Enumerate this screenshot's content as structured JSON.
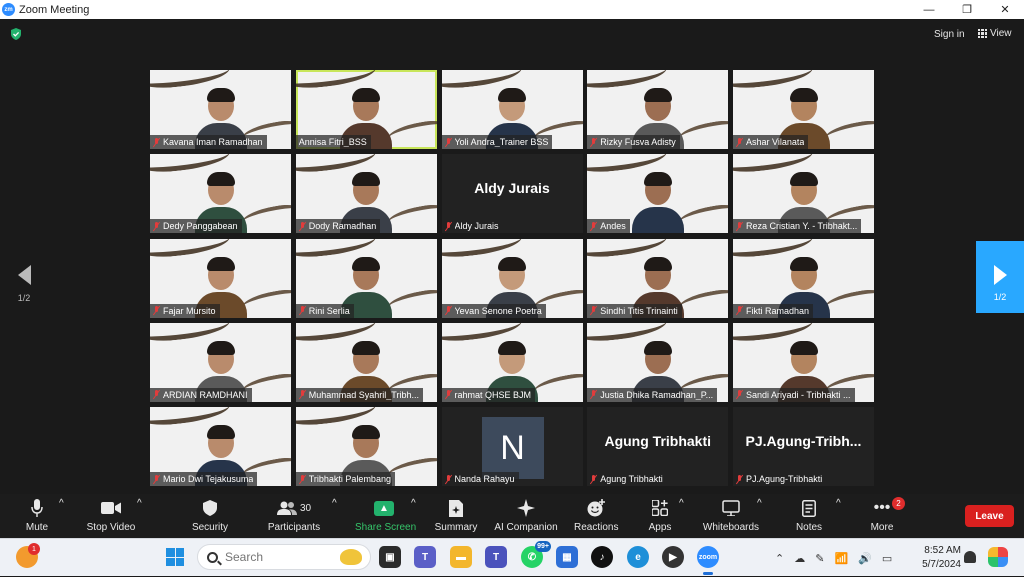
{
  "window": {
    "title": "Zoom Meeting",
    "logo_text": "zm",
    "controls": [
      "—",
      "❐",
      "✕"
    ]
  },
  "header": {
    "sign_in": "Sign in",
    "view": "View"
  },
  "pagination": {
    "prev_page": "1/2",
    "next_page": "1/2"
  },
  "participants": [
    {
      "name": "Kavana Iman Ramadhan",
      "muted": true,
      "video": true
    },
    {
      "name": "Annisa Fitri_BSS",
      "muted": false,
      "video": true,
      "active_speaker": true
    },
    {
      "name": "Yoli Andra_Trainer BSS",
      "muted": true,
      "video": true
    },
    {
      "name": "Rizky Fusva Adisty",
      "muted": true,
      "video": true
    },
    {
      "name": "Ashar Vilanata",
      "muted": true,
      "video": true
    },
    {
      "name": "Dedy Panggabean",
      "muted": true,
      "video": true
    },
    {
      "name": "Dody Ramadhan",
      "muted": true,
      "video": true
    },
    {
      "name": "Aldy Jurais",
      "muted": true,
      "video": false,
      "display_name": "Aldy Jurais"
    },
    {
      "name": "Andes",
      "muted": true,
      "video": true
    },
    {
      "name": "Reza Cristian Y. - Tribhakt...",
      "muted": true,
      "video": true
    },
    {
      "name": "Fajar Mursito",
      "muted": true,
      "video": true
    },
    {
      "name": "Rini Serlia",
      "muted": true,
      "video": true
    },
    {
      "name": "Yevan Senone Poetra",
      "muted": true,
      "video": true
    },
    {
      "name": "Sindhi Titis Trinainti",
      "muted": true,
      "video": true
    },
    {
      "name": "Fikti Ramadhan",
      "muted": true,
      "video": true
    },
    {
      "name": "ARDIAN RAMDHANI",
      "muted": true,
      "video": true
    },
    {
      "name": "Muhammad Syahril_Tribh...",
      "muted": true,
      "video": true
    },
    {
      "name": "rahmat QHSE BJM",
      "muted": true,
      "video": true
    },
    {
      "name": "Justia Dhika Ramadhan_P...",
      "muted": true,
      "video": true
    },
    {
      "name": "Sandi Ariyadi - Tribhakti ...",
      "muted": true,
      "video": true
    },
    {
      "name": "Mario Dwi Tejakusuma",
      "muted": true,
      "video": true
    },
    {
      "name": "Tribhakti Palembang",
      "muted": true,
      "video": true
    },
    {
      "name": "Nanda Rahayu",
      "muted": true,
      "video": false,
      "avatar_letter": "N"
    },
    {
      "name": "Agung Tribhakti",
      "muted": true,
      "video": false,
      "display_name": "Agung Tribhakti"
    },
    {
      "name": "PJ.Agung-Tribhakti",
      "muted": true,
      "video": false,
      "display_name": "PJ.Agung-Tribh..."
    }
  ],
  "toolbar": {
    "mute": "Mute",
    "stop_video": "Stop Video",
    "security": "Security",
    "participants": "Participants",
    "participants_count": "30",
    "share_screen": "Share Screen",
    "summary": "Summary",
    "ai_companion": "AI Companion",
    "reactions": "Reactions",
    "apps": "Apps",
    "whiteboards": "Whiteboards",
    "notes": "Notes",
    "more": "More",
    "more_badge": "2",
    "leave": "Leave"
  },
  "taskbar": {
    "weather_badge": "1",
    "search_placeholder": "Search",
    "whatsapp_badge": "99+",
    "clock_time": "8:52 AM",
    "clock_date": "5/7/2024",
    "apps": [
      "file-explorer",
      "teams",
      "folder",
      "teams-work",
      "whatsapp",
      "store",
      "tiktok",
      "edge",
      "media-player",
      "zoom"
    ]
  },
  "colors": {
    "active_speaker_outline": "#c8e65a",
    "next_page": "#29a8ff",
    "leave": "#d9201f",
    "share_screen": "#23b26d",
    "muted_icon": "#e23c3c"
  }
}
